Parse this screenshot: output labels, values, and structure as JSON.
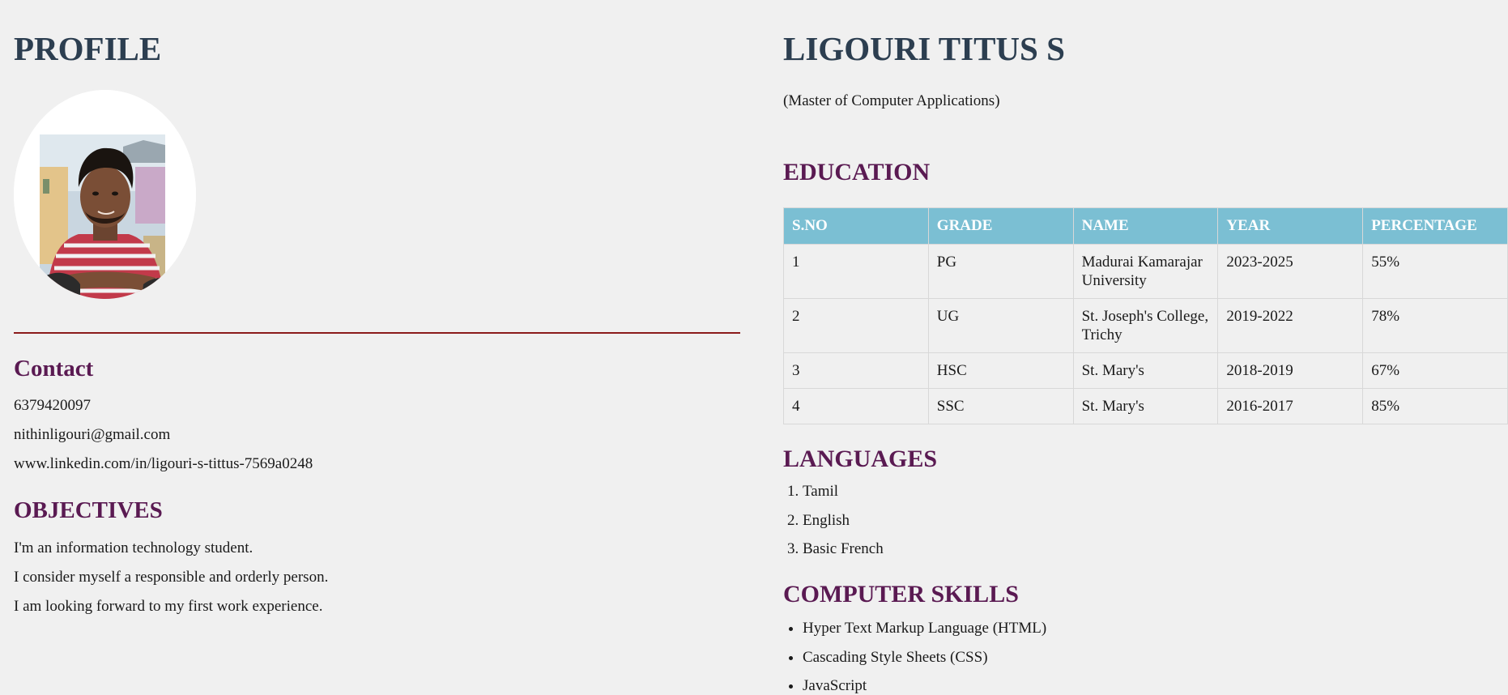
{
  "profile": {
    "heading": "PROFILE"
  },
  "contact": {
    "title": "Contact",
    "phone": "6379420097",
    "email": "nithinligouri@gmail.com",
    "linkedin": "www.linkedin.com/in/ligouri-s-tittus-7569a0248"
  },
  "objectives": {
    "title": "OBJECTIVES",
    "lines": [
      "I'm an information technology student.",
      "I consider myself a responsible and orderly person.",
      "I am looking forward to my first work experience."
    ]
  },
  "header": {
    "name": "LIGOURI TITUS S",
    "degree": "(Master of Computer Applications)"
  },
  "education": {
    "title": "EDUCATION",
    "columns": [
      "S.NO",
      "GRADE",
      "NAME",
      "YEAR",
      "PERCENTAGE"
    ],
    "rows": [
      [
        "1",
        "PG",
        "Madurai Kamarajar University",
        "2023-2025",
        "55%"
      ],
      [
        "2",
        "UG",
        "St. Joseph's College, Trichy",
        "2019-2022",
        "78%"
      ],
      [
        "3",
        "HSC",
        "St. Mary's",
        "2018-2019",
        "67%"
      ],
      [
        "4",
        "SSC",
        "St. Mary's",
        "2016-2017",
        "85%"
      ]
    ]
  },
  "languages": {
    "title": "LANGUAGES",
    "items": [
      "Tamil",
      "English",
      "Basic French"
    ]
  },
  "skills": {
    "title": "COMPUTER SKILLS",
    "items": [
      "Hyper Text Markup Language (HTML)",
      "Cascading Style Sheets (CSS)",
      "JavaScript"
    ]
  },
  "colors": {
    "background": "#f0f0f0",
    "heading": "#2c3e50",
    "section_title": "#5a1a52",
    "table_header": "#7bbfd3",
    "divider": "#8b1a1a"
  }
}
